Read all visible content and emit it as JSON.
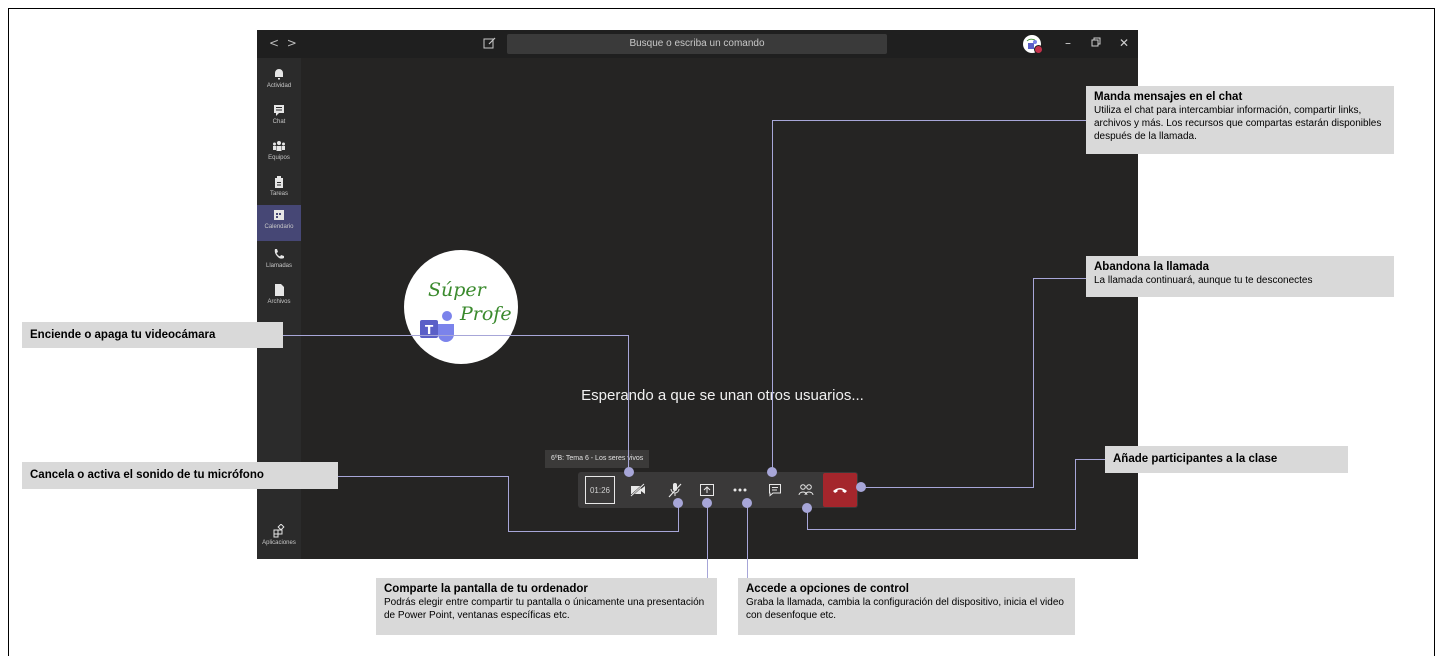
{
  "teams": {
    "search_placeholder": "Busque o escriba un comando",
    "nav_back": "<",
    "nav_forward": ">",
    "avatar_text": "Súper Profe",
    "rail": [
      {
        "label": "Actividad",
        "icon": "bell-icon"
      },
      {
        "label": "Chat",
        "icon": "chat-icon"
      },
      {
        "label": "Equipos",
        "icon": "teams-icon"
      },
      {
        "label": "Tareas",
        "icon": "assignments-icon"
      },
      {
        "label": "Calendario",
        "icon": "calendar-icon"
      },
      {
        "label": "Llamadas",
        "icon": "phone-icon"
      },
      {
        "label": "Archivos",
        "icon": "file-icon"
      }
    ],
    "apps_label": "Aplicaciones",
    "logo_text_1": "Súper",
    "logo_text_2": "Profe",
    "waiting_text": "Esperando a que se unan otros usuarios...",
    "meeting_title": "6ºB: Tema 6 - Los seres vivos",
    "timer": "01:26",
    "colors": {
      "accent": "#a7a6d8",
      "hangup": "#a4262c",
      "rail_active": "#464775",
      "bg": "#252423"
    }
  },
  "callouts": {
    "chat": {
      "title": "Manda mensajes en el chat",
      "desc": "Utiliza el chat para intercambiar información, compartir links, archivos y más. Los recursos que compartas estarán disponibles después de la llamada."
    },
    "leave": {
      "title": "Abandona la llamada",
      "desc": "La llamada continuará, aunque tu te desconectes"
    },
    "camera": {
      "title": "Enciende o apaga tu videocámara"
    },
    "mic": {
      "title": "Cancela o activa el sonido de tu micrófono"
    },
    "participants": {
      "title": "Añade participantes a la clase"
    },
    "share": {
      "title": "Comparte la pantalla de tu ordenador",
      "desc": "Podrás elegir entre compartir tu pantalla o únicamente una presentación de Power Point, ventanas específicas etc."
    },
    "options": {
      "title": "Accede a opciones de control",
      "desc": "Graba la llamada, cambia la configuración del dispositivo, inicia el video con desenfoque etc."
    }
  }
}
